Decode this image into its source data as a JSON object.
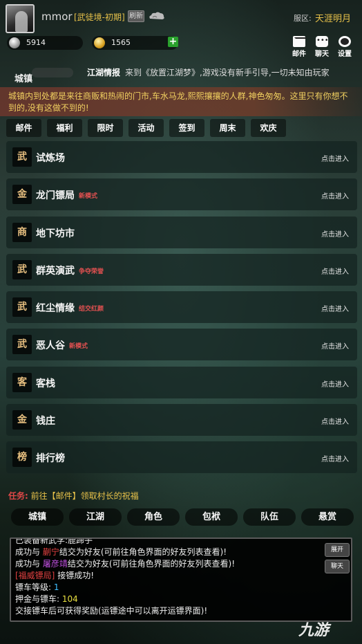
{
  "header": {
    "username": "mmor",
    "realm": "[武徒境-初期]",
    "refresh_label": "刷新",
    "server_label": "服区:",
    "server_name": "天涯明月"
  },
  "currency": {
    "silver": "5914",
    "gold": "1565",
    "silver_icon": "silver-ingot-icon",
    "gold_icon": "gold-ingot-icon"
  },
  "top_buttons": {
    "mail": "邮件",
    "chat": "聊天",
    "settings": "设置"
  },
  "town": {
    "title": "城镇",
    "news_label": "江湖情报",
    "news_text": "来到《放置江湖梦》,游戏没有新手引导,一切未知由玩家",
    "description": "城镇内到处都是来往商贩和热闹的门市,车水马龙,熙熙攘攘的人群,神色匆匆。这里只有你想不到的,没有这做不到的!"
  },
  "activity_tabs": [
    "邮件",
    "福利",
    "限时",
    "活动",
    "签到",
    "周末",
    "欢庆"
  ],
  "locations": [
    {
      "badge": "武",
      "name": "试炼场",
      "tag": "",
      "enter": "点击进入"
    },
    {
      "badge": "金",
      "name": "龙门镖局",
      "tag": "新模式",
      "enter": "点击进入"
    },
    {
      "badge": "商",
      "name": "地下坊市",
      "tag": "",
      "enter": "点击进入"
    },
    {
      "badge": "武",
      "name": "群英演武",
      "tag": "争夺荣誉",
      "enter": "点击进入"
    },
    {
      "badge": "武",
      "name": "红尘情缘",
      "tag": "结交红颜",
      "enter": "点击进入"
    },
    {
      "badge": "武",
      "name": "恶人谷",
      "tag": "新模式",
      "enter": "点击进入"
    },
    {
      "badge": "客",
      "name": "客栈",
      "tag": "",
      "enter": "点击进入"
    },
    {
      "badge": "金",
      "name": "钱庄",
      "tag": "",
      "enter": "点击进入"
    },
    {
      "badge": "榜",
      "name": "排行榜",
      "tag": "",
      "enter": "点击进入"
    }
  ],
  "task": {
    "label": "任务:",
    "text": "前往【邮件】领取村长的祝福"
  },
  "bottom_nav": [
    "城镇",
    "江湖",
    "角色",
    "包袱",
    "队伍",
    "悬赏"
  ],
  "chat": {
    "expand_label": "展开",
    "chat_label": "聊天",
    "lines": {
      "l0": "已装备新武学:鹿蹄手",
      "l1_pre": "成功与 ",
      "l1_name": "蒯宁",
      "l1_post": "结交为好友(可前往角色界面的好友列表查看)!",
      "l2_pre": "成功与 ",
      "l2_name": "屠彦靖",
      "l2_post": "结交为好友(可前往角色界面的好友列表查看)!",
      "l3_name": "[福威镖局]",
      "l3_post": " 接镖成功!",
      "l4_pre": "镖车等级: ",
      "l4_val": "1",
      "l5_pre": "押金与镖车: ",
      "l5_val": "104",
      "l6": "交接镖车后可获得奖励(运镖途中可以离开运镖界面)!"
    }
  },
  "watermark": "九游"
}
